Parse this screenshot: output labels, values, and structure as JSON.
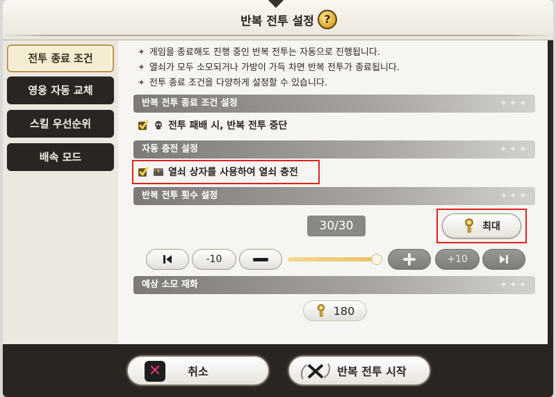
{
  "dialog": {
    "title": "반복 전투 설정",
    "help_label": "?"
  },
  "sidebar": {
    "tabs": [
      {
        "label": "전투 종료 조건",
        "active": true
      },
      {
        "label": "영웅 자동 교체",
        "active": false
      },
      {
        "label": "스킬 우선순위",
        "active": false
      },
      {
        "label": "배속 모드",
        "active": false
      }
    ]
  },
  "info": {
    "bullet": "✦",
    "lines": [
      "게임을 종료해도 진행 중인 반복 전투는 자동으로 진행됩니다.",
      "열쇠가 모두 소모되거나 가방이 가득 차면 반복 전투가 종료됩니다.",
      "전투 종료 조건을 다양하게 설정할 수 있습니다."
    ]
  },
  "sections": {
    "end_condition": "반복 전투 종료 조건 설정",
    "auto_charge": "자동 충전 설정",
    "repeat_count": "반복 전투 횟수 설정",
    "expected_cost": "예상 소모 재화",
    "sparkle": "✦✦✦"
  },
  "options": {
    "stop_on_defeat": {
      "label": "전투 패배 시, 반복 전투 중단",
      "checked": true
    },
    "key_box_charge": {
      "label": "열쇠 상자를 사용하여 열쇠 충전",
      "checked": true
    }
  },
  "repeat": {
    "count_display": "30/30",
    "max_label": "최대",
    "minus10_label": "-10",
    "plus10_label": "+10",
    "slider_fraction": 1.0
  },
  "cost": {
    "value": "180"
  },
  "footer": {
    "cancel_label": "취소",
    "start_label": "반복 전투 시작"
  },
  "colors": {
    "highlight": "#e0201e",
    "dark_frame": "#2b2521",
    "slider_fill": "#e8c25f"
  }
}
